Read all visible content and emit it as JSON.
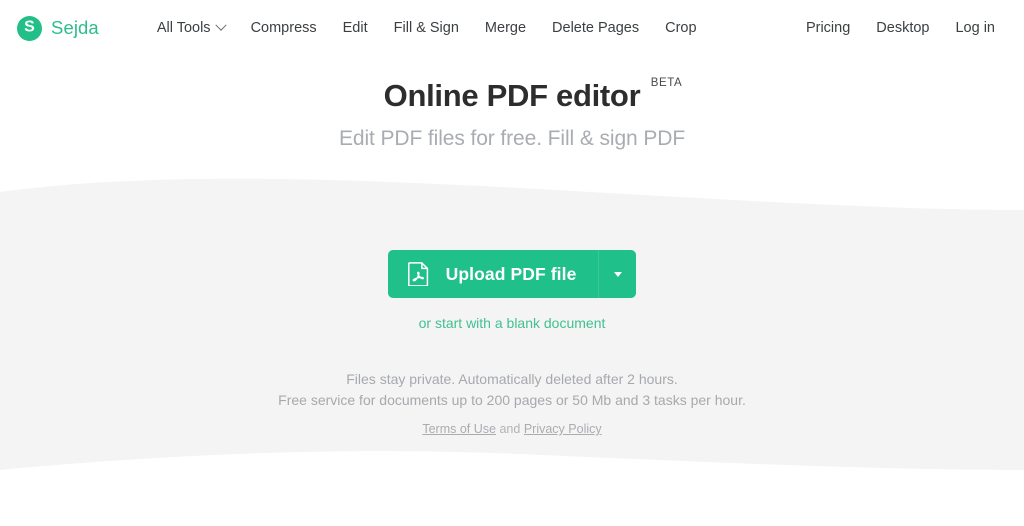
{
  "brand": {
    "mark_letter": "S",
    "name": "Sejda"
  },
  "nav": {
    "main_items": [
      {
        "label": "All Tools",
        "has_caret": true
      },
      {
        "label": "Compress",
        "has_caret": false
      },
      {
        "label": "Edit",
        "has_caret": false
      },
      {
        "label": "Fill & Sign",
        "has_caret": false
      },
      {
        "label": "Merge",
        "has_caret": false
      },
      {
        "label": "Delete Pages",
        "has_caret": false
      },
      {
        "label": "Crop",
        "has_caret": false
      }
    ],
    "right_items": [
      {
        "label": "Pricing"
      },
      {
        "label": "Desktop"
      },
      {
        "label": "Log in"
      }
    ]
  },
  "hero": {
    "title": "Online PDF editor",
    "badge": "BETA",
    "subtitle": "Edit PDF files for free. Fill & sign PDF"
  },
  "upload": {
    "button_label": "Upload PDF file",
    "blank_document_link": "or start with a blank document",
    "fineprint_line1": "Files stay private. Automatically deleted after 2 hours.",
    "fineprint_line2": "Free service for documents up to 200 pages or 50 Mb and 3 tasks per hour.",
    "legal_terms": "Terms of Use",
    "legal_and": "and",
    "legal_privacy": "Privacy Policy"
  },
  "colors": {
    "brand_green": "#2ebd8a",
    "button_green": "#20c08a",
    "band_gray": "#f4f4f4",
    "link_green": "#41c191",
    "muted_text": "#a9adb1"
  }
}
